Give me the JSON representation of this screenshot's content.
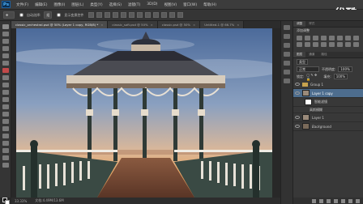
{
  "menu": {
    "logo": "Ps",
    "items": [
      "文件(F)",
      "编辑(E)",
      "图像(I)",
      "图层(L)",
      "类型(Y)",
      "选择(S)",
      "滤镜(T)",
      "3D(D)",
      "视图(V)",
      "窗口(W)",
      "帮助(H)"
    ]
  },
  "watermark": "优酷",
  "options": {
    "auto_select_label": "自动选择:",
    "auto_select_value": "组",
    "transform_label": "显示变换控件"
  },
  "tabs": [
    {
      "label": "classic_orchestral.psd @ 50% (Layer 1 copy, RGB/8) *",
      "active": true
    },
    {
      "label": "classic_soft.psd @ 50%",
      "active": false
    },
    {
      "label": "classic.psd @ 50%",
      "active": false
    },
    {
      "label": "Untitled-1 @ 66.7%",
      "active": false
    }
  ],
  "status": {
    "zoom": "33.33%",
    "doc": "文档:4.49M/13.6M"
  },
  "adjustments": {
    "tab1": "调整",
    "tab2": "样式",
    "heading": "添加调整"
  },
  "layers_panel": {
    "tab1": "图层",
    "tab2": "通道",
    "tab3": "路径",
    "kind_label": "类型",
    "blend_mode": "正常",
    "opacity_label": "不透明度:",
    "opacity_value": "100%",
    "lock_label": "锁定:",
    "fill_label": "填充:",
    "fill_value": "100%",
    "layers": [
      {
        "name": "Group 1",
        "type": "group",
        "selected": false
      },
      {
        "name": "Layer 1 copy",
        "type": "layer",
        "selected": true
      },
      {
        "name": "智能滤镜",
        "type": "filter",
        "selected": false
      },
      {
        "name": "高斯模糊",
        "type": "filter-item",
        "selected": false
      },
      {
        "name": "Layer 1",
        "type": "layer",
        "selected": false
      },
      {
        "name": "Background",
        "type": "background",
        "selected": false
      }
    ]
  }
}
